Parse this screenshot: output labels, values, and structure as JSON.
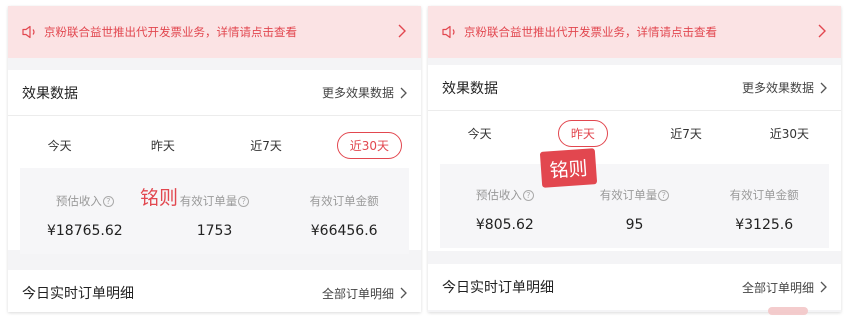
{
  "left": {
    "notice": "京粉联合益世推出代开发票业务，详情请点击查看",
    "effect": {
      "title": "效果数据",
      "more": "更多效果数据"
    },
    "tabs": [
      "今天",
      "昨天",
      "近7天",
      "近30天"
    ],
    "active_tab": "近30天",
    "metrics": [
      {
        "label": "预估收入",
        "value": "¥18765.62"
      },
      {
        "label": "有效订单量",
        "value": "1753"
      },
      {
        "label": "有效订单金额",
        "value": "¥66456.6"
      }
    ],
    "detail": {
      "title": "今日实时订单明细",
      "more": "全部订单明细"
    }
  },
  "right": {
    "notice": "京粉联合益世推出代开发票业务，详情请点击查看",
    "effect": {
      "title": "效果数据",
      "more": "更多效果数据"
    },
    "tabs": [
      "今天",
      "昨天",
      "近7天",
      "近30天"
    ],
    "active_tab": "昨天",
    "metrics": [
      {
        "label": "预估收入",
        "value": "¥805.62"
      },
      {
        "label": "有效订单量",
        "value": "95"
      },
      {
        "label": "有效订单金额",
        "value": "¥3125.6"
      }
    ],
    "detail": {
      "title": "今日实时订单明细",
      "more": "全部订单明细"
    }
  },
  "watermark": "铭则",
  "colors": {
    "accent": "#e2474f",
    "notice_bg": "#fbe3e4",
    "page_bg": "#f4f4f6"
  },
  "icons": [
    "speaker-icon",
    "chevron-right-icon",
    "question-icon"
  ]
}
